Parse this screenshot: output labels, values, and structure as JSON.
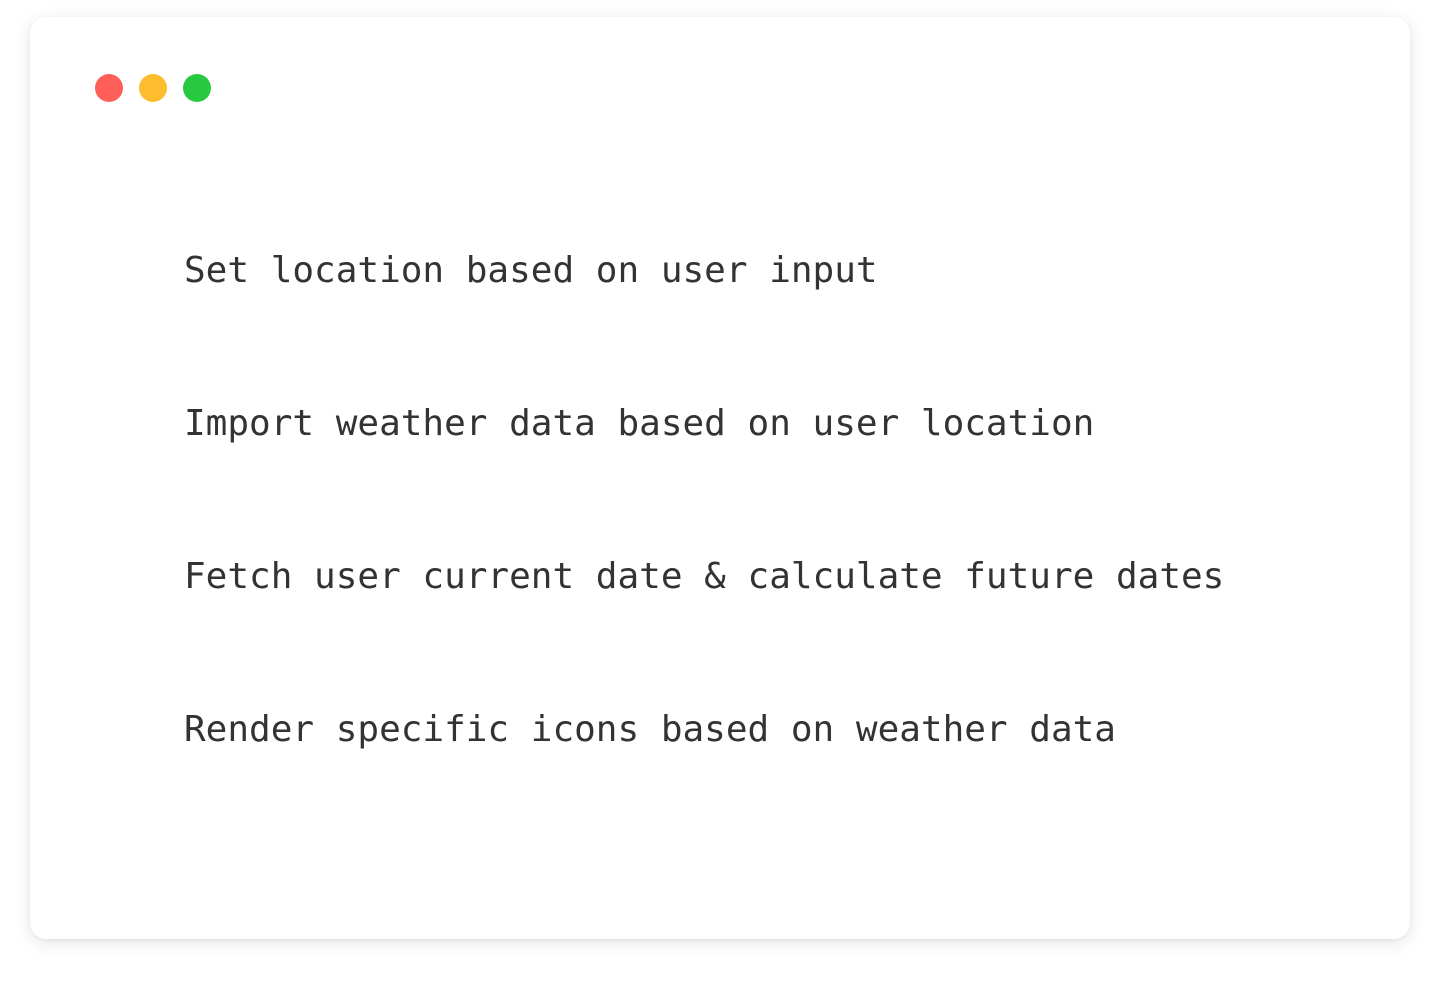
{
  "window": {
    "controls": [
      {
        "name": "close-button",
        "color": "#ff5f57"
      },
      {
        "name": "minimize-button",
        "color": "#febc2e"
      },
      {
        "name": "maximize-button",
        "color": "#28c840"
      }
    ]
  },
  "content": {
    "lines": [
      "Set location based on user input",
      "Import weather data based on user location",
      "Fetch user current date & calculate future dates",
      "Render specific icons based on weather data"
    ]
  },
  "colors": {
    "text": "#333333",
    "background": "#ffffff"
  }
}
